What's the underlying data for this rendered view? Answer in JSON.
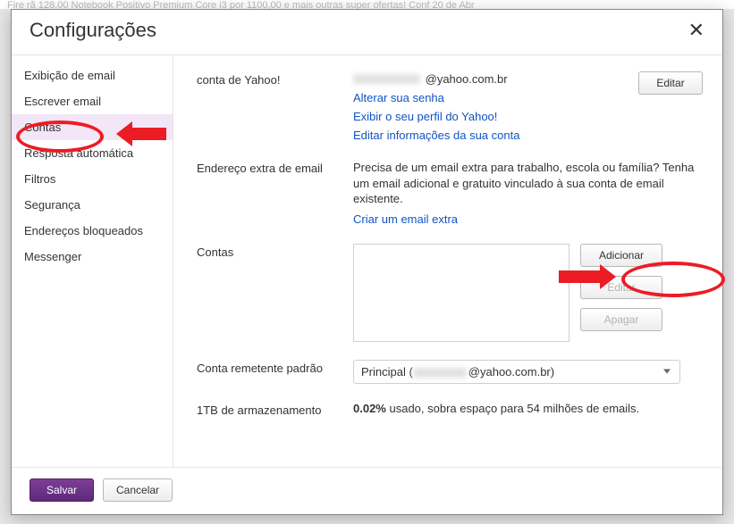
{
  "bg_text": "Fire rã 128.00  Notebook Positivo Premium Core i3 por 1100,00 e mais outras super ofertas! Conf                                    20 de Abr",
  "header": {
    "title": "Configurações"
  },
  "sidebar": {
    "items": [
      {
        "label": "Exibição de email"
      },
      {
        "label": "Escrever email"
      },
      {
        "label": "Contas",
        "active": true
      },
      {
        "label": "Resposta automática"
      },
      {
        "label": "Filtros"
      },
      {
        "label": "Segurança"
      },
      {
        "label": "Endereços bloqueados"
      },
      {
        "label": "Messenger"
      }
    ]
  },
  "account": {
    "label": "conta de Yahoo!",
    "email_domain": "@yahoo.com.br",
    "edit_btn": "Editar",
    "links": {
      "change_pw": "Alterar sua senha",
      "show_profile": "Exibir o seu perfil do Yahoo!",
      "edit_info": "Editar informações da sua conta"
    }
  },
  "extra": {
    "label": "Endereço extra de email",
    "desc": "Precisa de um email extra para trabalho, escola ou família? Tenha um email adicional e gratuito vinculado à sua conta de email existente.",
    "link": "Criar um email extra"
  },
  "accounts_box": {
    "label": "Contas",
    "add_btn": "Adicionar",
    "edit_btn": "Editar",
    "delete_btn": "Apagar"
  },
  "default_sender": {
    "label": "Conta remetente padrão",
    "value_prefix": "Principal (",
    "value_suffix": "@yahoo.com.br)"
  },
  "storage": {
    "label": "1TB de armazenamento",
    "pct": "0.02%",
    "text": " usado, sobra espaço para 54 milhões de emails."
  },
  "footer": {
    "save": "Salvar",
    "cancel": "Cancelar"
  }
}
